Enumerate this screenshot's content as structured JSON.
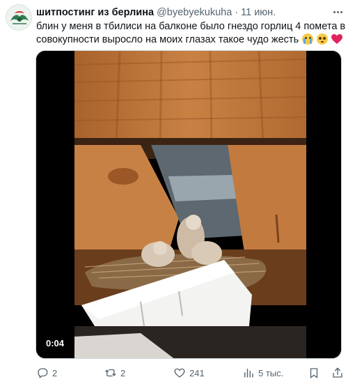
{
  "author": {
    "display_name": "шитпостинг из берлина",
    "handle": "@byebyekukuha",
    "separator": "·",
    "date": "11 июн."
  },
  "tweet": {
    "text_line_1": "блин у меня в тбилиси на балконе было гнездо горлиц 4 помета в",
    "text_line_2": "совокупности выросло на моих глазах такое чудо жесть",
    "emojis": [
      "loudly-crying-face",
      "pleading-face",
      "red-heart"
    ]
  },
  "media": {
    "type": "video",
    "duration": "0:04"
  },
  "actions": {
    "replies": "2",
    "reposts": "2",
    "likes": "241",
    "views": "5 тыс."
  },
  "icons": [
    "more-icon",
    "reply-icon",
    "retweet-icon",
    "like-icon",
    "views-icon",
    "bookmark-icon",
    "share-icon"
  ],
  "colors": {
    "text_primary": "#0f1419",
    "text_secondary": "#536471",
    "heart": "#e0245e",
    "media_border": "#cfd9de"
  }
}
